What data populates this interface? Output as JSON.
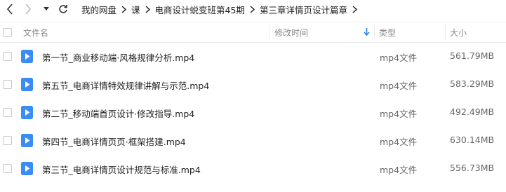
{
  "toolbar": {
    "back_icon": "chevron-left-icon",
    "forward_icon": "chevron-right-icon",
    "dropdown_icon": "caret-down-icon",
    "refresh_icon": "refresh-icon"
  },
  "breadcrumb": [
    "我的网盘",
    "课",
    "电商设计蜕变班第45期",
    "第三章详情页设计篇章"
  ],
  "table": {
    "headers": {
      "name": "文件名",
      "modified": "修改时间",
      "type": "类型",
      "size": "大小"
    },
    "sort_icon": "arrow-down-icon",
    "rows": [
      {
        "name": "第一节_商业移动端·风格规律分析.mp4",
        "type": "mp4文件",
        "size": "561.79MB"
      },
      {
        "name": "第五节_电商详情特效规律讲解与示范.mp4",
        "type": "mp4文件",
        "size": "583.29MB"
      },
      {
        "name": "第二节_移动端首页设计·修改指导.mp4",
        "type": "mp4文件",
        "size": "492.49MB"
      },
      {
        "name": "第四节_电商详情页页·框架搭建.mp4",
        "type": "mp4文件",
        "size": "630.14MB"
      },
      {
        "name": "第三节_电商详情页设计规范与标准.mp4",
        "type": "mp4文件",
        "size": "556.73MB"
      }
    ]
  },
  "colors": {
    "video_icon": "#3b8cf5",
    "sort_arrow": "#2b7de9"
  }
}
